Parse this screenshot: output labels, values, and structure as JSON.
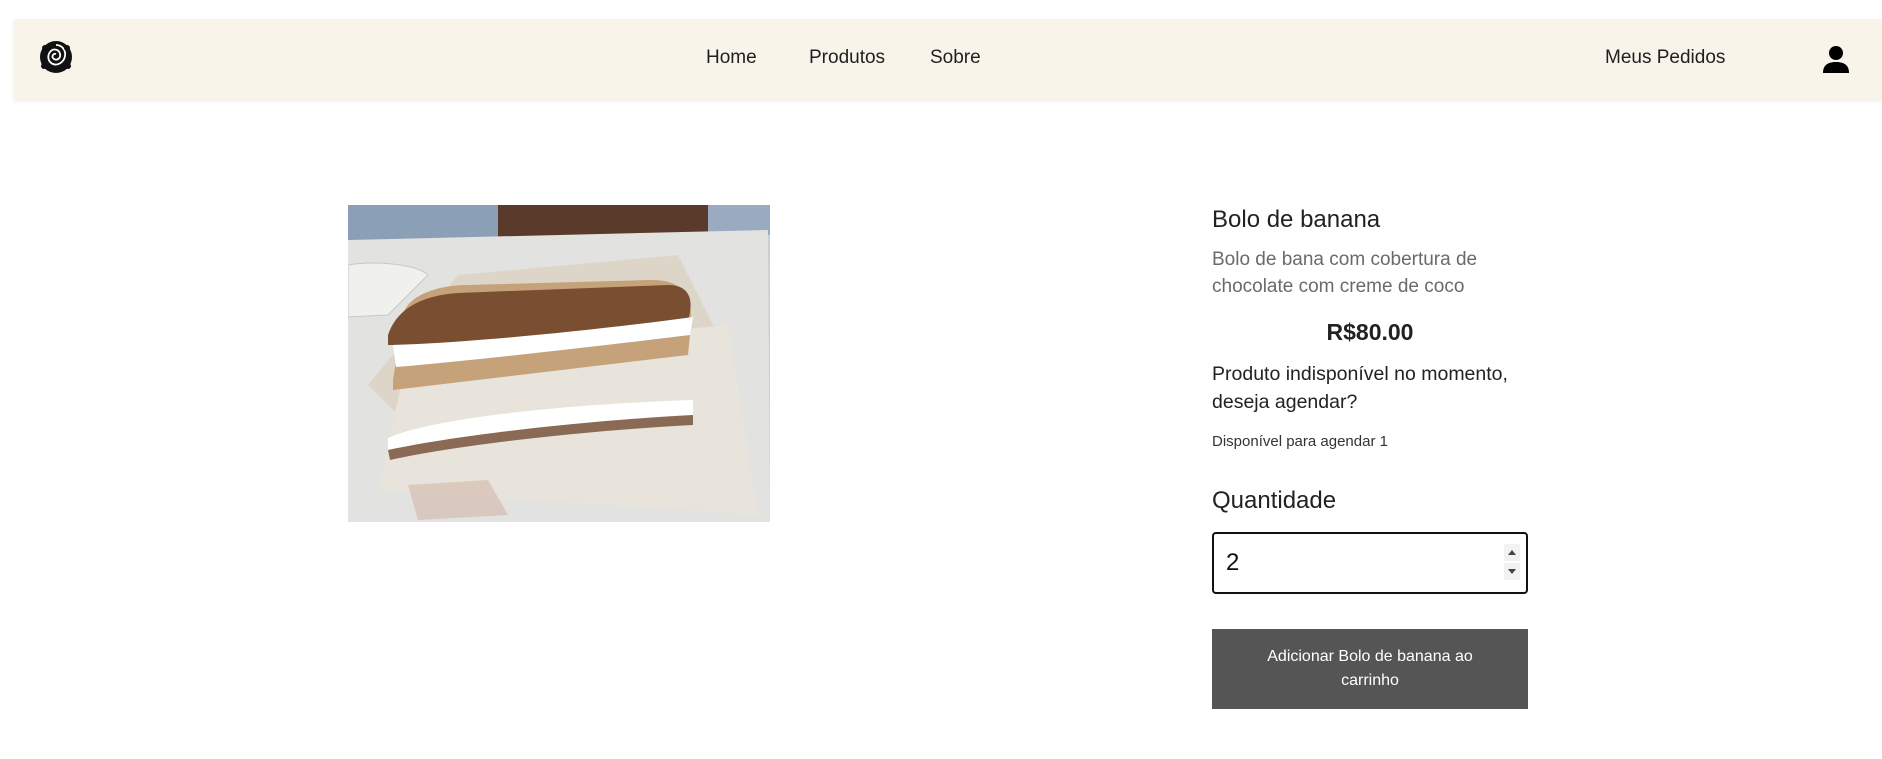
{
  "nav": {
    "logo": "rose-logo-icon",
    "links": [
      "Home",
      "Produtos",
      "Sobre"
    ],
    "orders_link": "Meus Pedidos",
    "user_icon": "user-icon",
    "background": "#f8f4ea"
  },
  "product": {
    "image": "banana-cake-photo",
    "name": "Bolo de banana",
    "description": "Bolo de bana com cobertura de chocolate com creme de coco",
    "price": "R$80.00",
    "unavailable_message": "Produto indisponível no momento, deseja agendar?",
    "available_note": "Disponível para agendar 1",
    "quantity_label": "Quantidade",
    "quantity_value": "2",
    "add_button": "Adicionar Bolo de banana ao carrinho",
    "button_color": "#555555"
  }
}
